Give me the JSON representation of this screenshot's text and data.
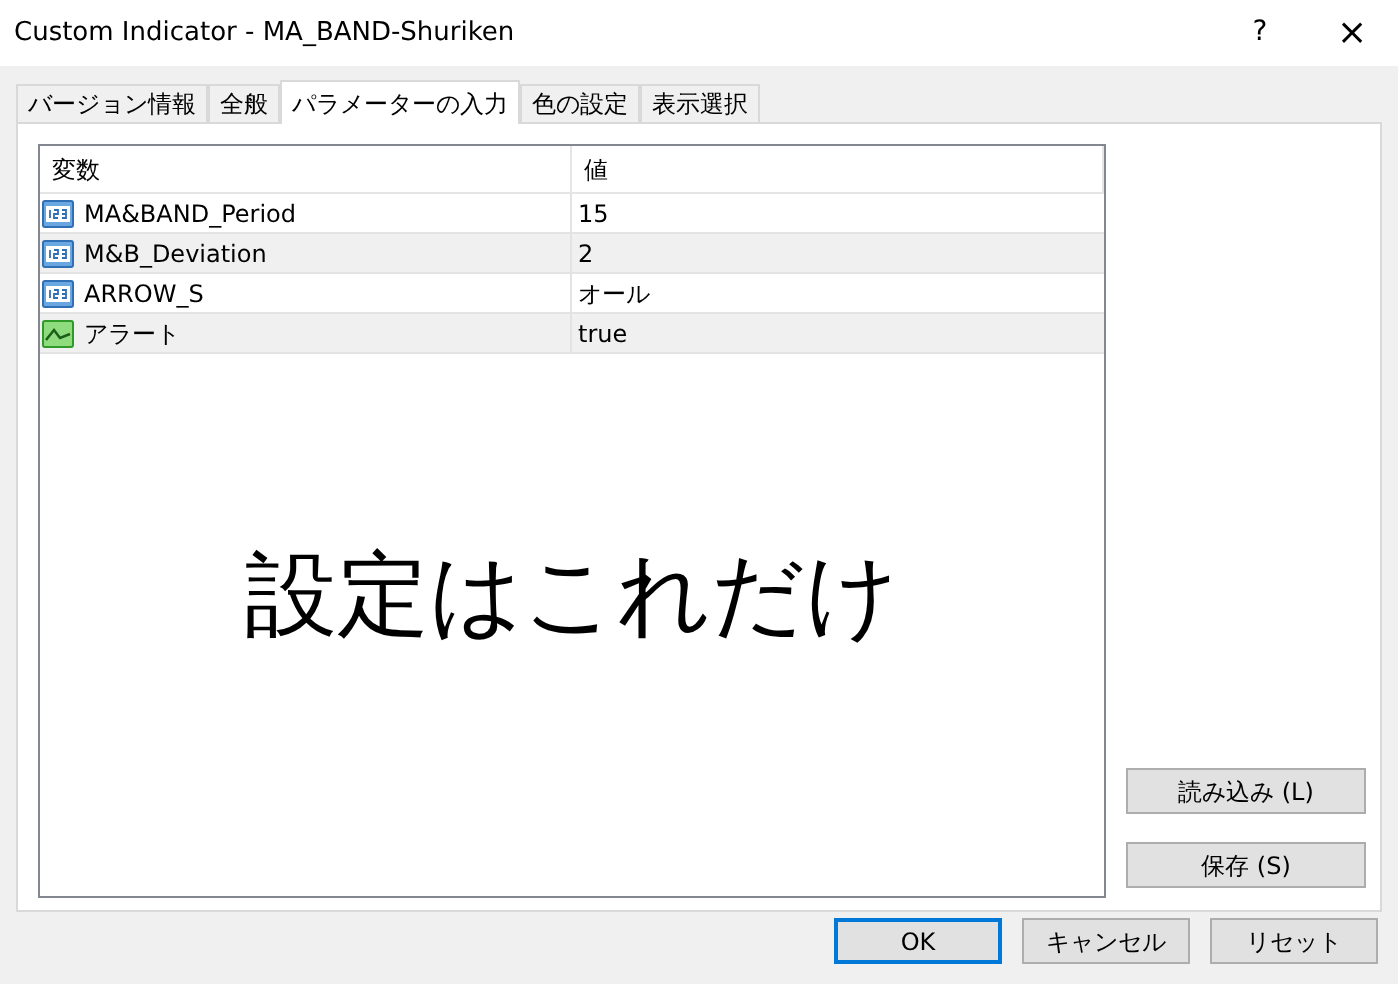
{
  "window": {
    "title": "Custom Indicator - MA_BAND-Shuriken",
    "help": "?",
    "close": "×"
  },
  "tabs": [
    {
      "label": "バージョン情報",
      "selected": false
    },
    {
      "label": "全般",
      "selected": false
    },
    {
      "label": "パラメーターの入力",
      "selected": true
    },
    {
      "label": "色の設定",
      "selected": false
    },
    {
      "label": "表示選択",
      "selected": false
    }
  ],
  "table": {
    "columns": [
      "変数",
      "値"
    ],
    "rows": [
      {
        "kind": "number",
        "name": "MA&BAND_Period",
        "value": "15"
      },
      {
        "kind": "number",
        "name": "M&B_Deviation",
        "value": "2"
      },
      {
        "kind": "number",
        "name": "ARROW_S",
        "value": "オール"
      },
      {
        "kind": "bool",
        "name": "アラート",
        "value": "true"
      }
    ]
  },
  "overlay_text": "設定はこれだけ",
  "side_buttons": [
    "読み込み (L)",
    "保存 (S)"
  ],
  "buttons": [
    {
      "label": "OK",
      "default": true
    },
    {
      "label": "キャンセル",
      "default": false
    },
    {
      "label": "リセット",
      "default": false
    }
  ]
}
